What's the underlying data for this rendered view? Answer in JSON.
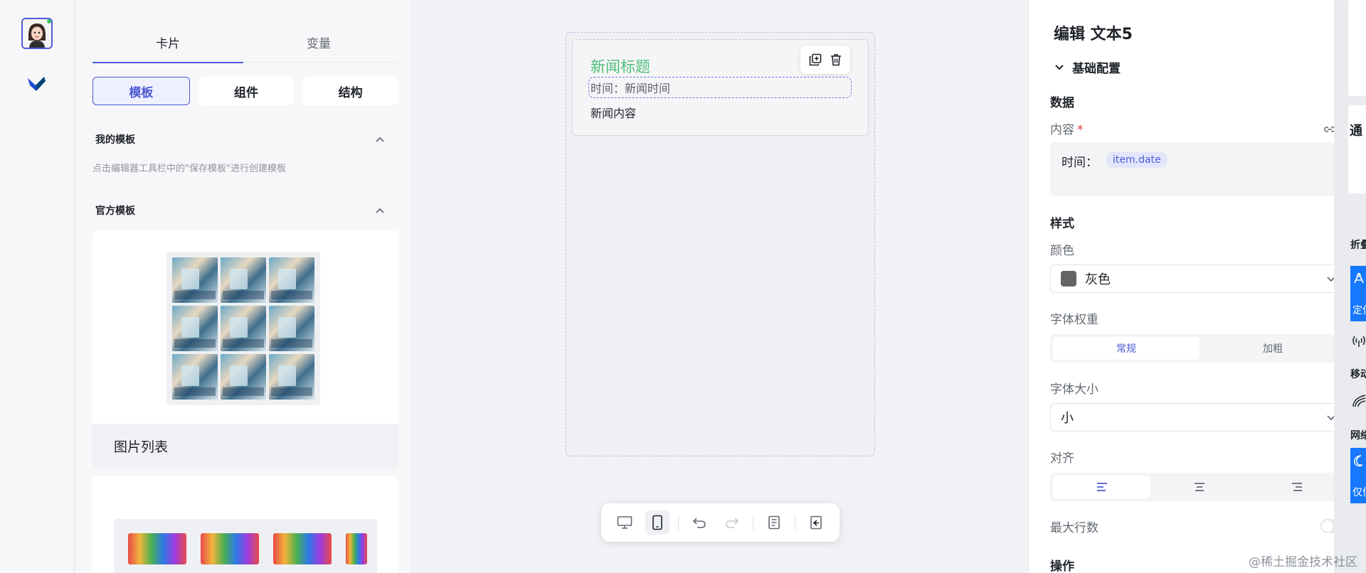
{
  "left_panel": {
    "tabs": [
      {
        "label": "卡片"
      },
      {
        "label": "变量"
      }
    ],
    "segments": [
      {
        "label": "模板"
      },
      {
        "label": "组件"
      },
      {
        "label": "结构"
      }
    ],
    "my_templates": {
      "title": "我的模板",
      "hint": "点击编辑器工具栏中的\"保存模板\"进行创建模板"
    },
    "official_templates": {
      "title": "官方模板"
    },
    "template_cards": [
      {
        "label": "图片列表"
      }
    ]
  },
  "canvas": {
    "card": {
      "title": "新闻标题",
      "time_text": "时间：新闻时间",
      "content": "新闻内容"
    }
  },
  "config": {
    "title": "编辑 文本5",
    "group": "基础配置",
    "data_header": "数据",
    "content_label": "内容",
    "required_mark": "*",
    "content_prefix": "时间：",
    "content_var": "item.date",
    "style_header": "样式",
    "color_label": "颜色",
    "color_value": "灰色",
    "color_hex": "#646464",
    "weight_label": "字体权重",
    "weight_options": [
      {
        "label": "常规"
      },
      {
        "label": "加粗"
      }
    ],
    "size_label": "字体大小",
    "size_value": "小",
    "align_label": "对齐",
    "maxlines_label": "最大行数",
    "ops_header": "操作"
  },
  "strip": {
    "labels": [
      "折叠",
      "移动",
      "网络"
    ],
    "blue_items": [
      {
        "label": "定位"
      },
      {
        "label": "仅供"
      }
    ],
    "top_card_text": "通"
  },
  "watermark": "@稀土掘金技术社区",
  "colors": {
    "accent": "#4c5ad6",
    "title_green": "#4fbf7a",
    "blue": "#1677ff"
  }
}
